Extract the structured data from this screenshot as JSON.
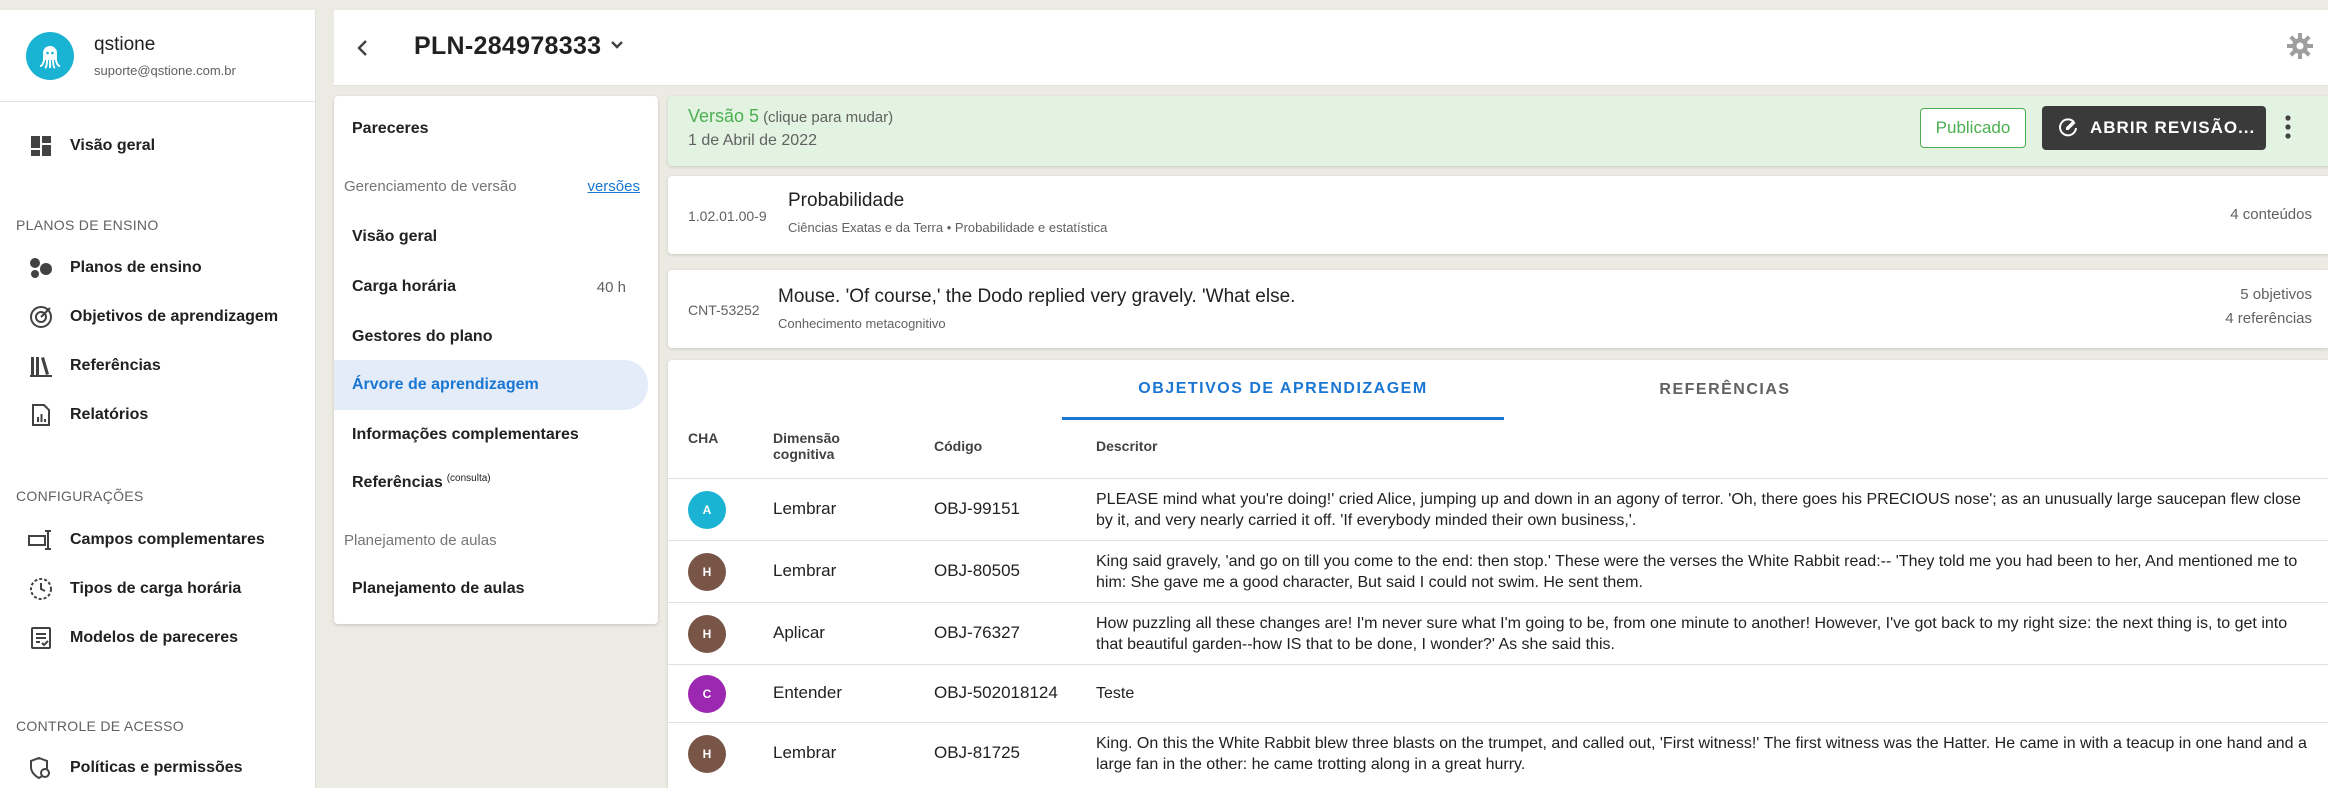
{
  "user": {
    "name": "qstione",
    "email": "suporte@qstione.com.br"
  },
  "nav": {
    "overview": "Visão geral",
    "sections": {
      "plans": "PLANOS DE ENSINO",
      "config": "CONFIGURAÇÕES",
      "access": "CONTROLE DE ACESSO"
    },
    "items": {
      "plans": "Planos de ensino",
      "objectives": "Objetivos de aprendizagem",
      "references": "Referências",
      "reports": "Relatórios",
      "fields": "Campos complementares",
      "workload_types": "Tipos de carga horária",
      "templates": "Modelos de pareceres",
      "policies": "Políticas e permissões"
    }
  },
  "header": {
    "plan_code": "PLN-284978333",
    "icons": [
      "chevron-left-icon",
      "chevron-down-icon",
      "gear-icon"
    ]
  },
  "submenu": {
    "pareceres": "Pareceres",
    "version_mgmt": "Gerenciamento de versão",
    "versions_link": "versões",
    "overview": "Visão geral",
    "workload": "Carga horária",
    "workload_value": "40 h",
    "managers": "Gestores do plano",
    "learning_tree": "Árvore de aprendizagem",
    "complementary": "Informações complementares",
    "references": "Referências",
    "references_sup": "(consulta)",
    "lessons_section": "Planejamento de aulas",
    "lessons": "Planejamento de aulas"
  },
  "version": {
    "label": "Versão 5",
    "hint": "(clique para mudar)",
    "date": "1 de Abril de 2022",
    "status": "Publicado",
    "open_review": "ABRIR REVISÃO...",
    "status_color": "#4caf50"
  },
  "discipline": {
    "code": "1.02.01.00-9",
    "title": "Probabilidade",
    "subtitle": "Ciências Exatas e da Terra • Probabilidade e estatística",
    "count": "4 conteúdos"
  },
  "content": {
    "code": "CNT-53252",
    "title": "Mouse. 'Of course,' the Dodo replied very gravely. 'What else.",
    "subtitle": "Conhecimento metacognitivo",
    "objectives": "5 objetivos",
    "references": "4 referências"
  },
  "tabs": {
    "objectives": "OBJETIVOS DE APRENDIZAGEM",
    "references": "REFERÊNCIAS"
  },
  "table": {
    "headers": {
      "cha": "CHA",
      "dimension_1": "Dimensão",
      "dimension_2": "cognitiva",
      "code": "Código",
      "descriptor": "Descritor"
    },
    "rows": [
      {
        "cha": "A",
        "color": "#1ab3d3",
        "dimension": "Lembrar",
        "code": "OBJ-99151",
        "descriptor": "PLEASE mind what you're doing!' cried Alice, jumping up and down in an agony of terror. 'Oh, there goes his PRECIOUS nose'; as an unusually large saucepan flew close by it, and very nearly carried it off. 'If everybody minded their own business,'."
      },
      {
        "cha": "H",
        "color": "#795548",
        "dimension": "Lembrar",
        "code": "OBJ-80505",
        "descriptor": "King said gravely, 'and go on till you come to the end: then stop.' These were the verses the White Rabbit read:-- 'They told me you had been to her, And mentioned me to him: She gave me a good character, But said I could not swim. He sent them."
      },
      {
        "cha": "H",
        "color": "#795548",
        "dimension": "Aplicar",
        "code": "OBJ-76327",
        "descriptor": "How puzzling all these changes are! I'm never sure what I'm going to be, from one minute to another! However, I've got back to my right size: the next thing is, to get into that beautiful garden--how IS that to be done, I wonder?' As she said this."
      },
      {
        "cha": "C",
        "color": "#9c27b0",
        "dimension": "Entender",
        "code": "OBJ-502018124",
        "descriptor": "Teste"
      },
      {
        "cha": "H",
        "color": "#795548",
        "dimension": "Lembrar",
        "code": "OBJ-81725",
        "descriptor": "King. On this the White Rabbit blew three blasts on the trumpet, and called out, 'First witness!' The first witness was the Hatter. He came in with a teacup in one hand and a large fan in the other: he came trotting along in a great hurry."
      }
    ]
  }
}
